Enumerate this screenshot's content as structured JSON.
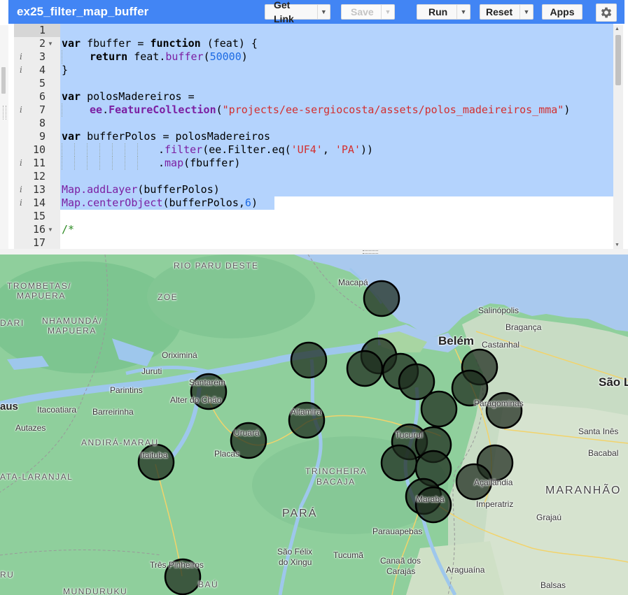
{
  "header": {
    "script_name": "ex25_filter_map_buffer",
    "get_link_label": "Get Link",
    "save_label": "Save",
    "run_label": "Run",
    "reset_label": "Reset",
    "apps_label": "Apps"
  },
  "editor": {
    "lines": [
      {
        "n": "1",
        "fold": "",
        "info": ""
      },
      {
        "n": "2",
        "fold": "▼",
        "info": ""
      },
      {
        "n": "3",
        "fold": "",
        "info": "i"
      },
      {
        "n": "4",
        "fold": "",
        "info": "i"
      },
      {
        "n": "5",
        "fold": "",
        "info": ""
      },
      {
        "n": "6",
        "fold": "",
        "info": ""
      },
      {
        "n": "7",
        "fold": "",
        "info": "i"
      },
      {
        "n": "8",
        "fold": "",
        "info": ""
      },
      {
        "n": "9",
        "fold": "",
        "info": ""
      },
      {
        "n": "10",
        "fold": "",
        "info": ""
      },
      {
        "n": "11",
        "fold": "",
        "info": "i"
      },
      {
        "n": "12",
        "fold": "",
        "info": ""
      },
      {
        "n": "13",
        "fold": "",
        "info": "i"
      },
      {
        "n": "14",
        "fold": "",
        "info": "i"
      },
      {
        "n": "15",
        "fold": "",
        "info": ""
      },
      {
        "n": "16",
        "fold": "▼",
        "info": ""
      },
      {
        "n": "17",
        "fold": "",
        "info": ""
      }
    ],
    "code": {
      "l2_a": "var",
      "l2_b": " fbuffer = ",
      "l2_c": "function",
      "l2_d": " (feat) {",
      "l3_a": "return",
      "l3_b": " feat.",
      "l3_c": "buffer",
      "l3_d": "(",
      "l3_e": "50000",
      "l3_f": ")",
      "l4": "}",
      "l6_a": "var",
      "l6_b": " polosMadereiros =",
      "l7_a": "ee",
      "l7_b": ".",
      "l7_c": "FeatureCollection",
      "l7_d": "(",
      "l7_e": "\"projects/ee-sergiocosta/assets/polos_madeireiros_mma\"",
      "l7_f": ")",
      "l9_a": "var",
      "l9_b": " bufferPolos = polosMadereiros",
      "l10_a": ".",
      "l10_b": "filter",
      "l10_c": "(",
      "l10_d": "ee.Filter.eq",
      "l10_e": "(",
      "l10_f": "'UF4'",
      "l10_g": ", ",
      "l10_h": "'PA'",
      "l10_i": "))",
      "l11_a": ".",
      "l11_b": "map",
      "l11_c": "(fbuffer)",
      "l13_a": "Map.addLayer",
      "l13_b": "(bufferPolos)",
      "l14_a": "Map.centerObject",
      "l14_b": "(bufferPolos,",
      "l14_c": "6",
      "l14_d": ")",
      "l16": "/*"
    }
  },
  "map": {
    "labels": {
      "rio_paru_deste": "RIO PARU DESTE",
      "trombetas_1": "TROMBETAS/",
      "trombetas_2": "MAPUERA",
      "zoe": "ZOE",
      "nhamunda_1": "NHAMUNDÁ/",
      "nhamunda_2": "MAPUERA",
      "dari": "DARI",
      "macapa": "Macapá",
      "salinopolis": "Salinópolis",
      "braganca": "Bragança",
      "belem": "Belém",
      "castanhal": "Castanhal",
      "oriximina": "Oriximiná",
      "juruti": "Juruti",
      "santarem": "Santarém",
      "alter_do_chao": "Alter do Chão",
      "parintins": "Parintins",
      "aus": "aus",
      "itacoatiara": "Itacoatiara",
      "barreirinha": "Barreirinha",
      "autazes": "Autazes",
      "andira_marau": "ANDIRÁ-MARAU",
      "ata_laranjal": "ATA-LARANJAL",
      "altamira": "Altamira",
      "uruara": "Uruará",
      "placas": "Placas",
      "itaituba": "Itaituba",
      "trincheira_1": "TRINCHEIRA",
      "trincheira_2": "BACAJA",
      "tucurui": "Tucuruí",
      "paragominas": "Paragominas",
      "sao_luis": "São L",
      "santa_ines": "Santa Inês",
      "bacabal": "Bacabal",
      "acailandia": "Açailândia",
      "maranhao": "MARANHÃO",
      "imperatriz": "Imperatriz",
      "maraba": "Marabá",
      "para": "PARÁ",
      "grajau": "Grajaú",
      "parauapebas": "Parauapebas",
      "sao_felix_1": "São Félix",
      "sao_felix_2": "do Xingu",
      "tucuma": "Tucumã",
      "canaa_1": "Canaã dos",
      "canaa_2": "Carajás",
      "araguaina": "Araguaína",
      "tres_pinheiros": "Três Pinheiros",
      "bau": "BAÚ",
      "munduruku": "MUNDURUKU",
      "balsas": "Balsas",
      "ru": "RU"
    },
    "buffer_fill": "#1c2a1c",
    "buffer_stroke": "#000000",
    "buffer_fill_opacity": 0.72
  }
}
